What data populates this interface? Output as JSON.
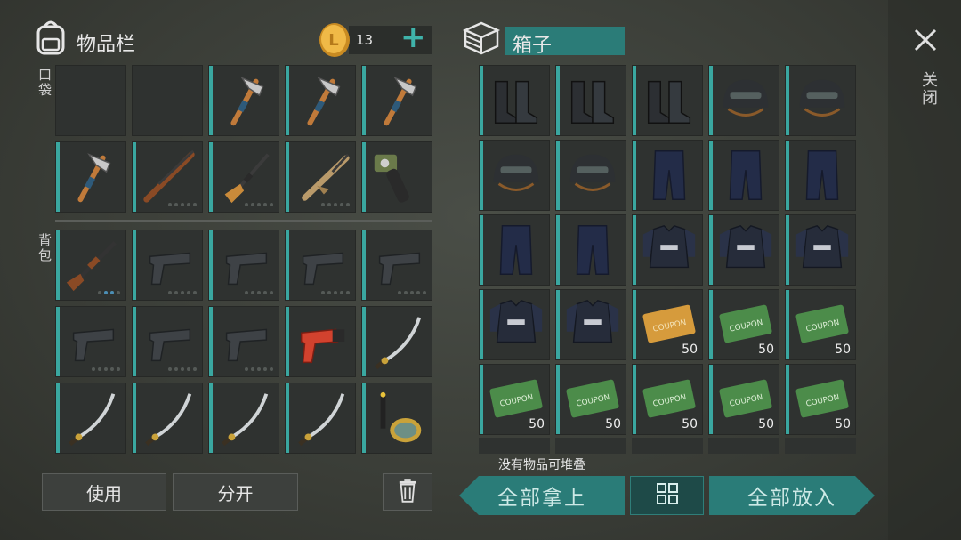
{
  "inventory": {
    "title": "物品栏",
    "pocket_label": "口袋",
    "backpack_label": "背包",
    "coins": "13",
    "add_symbol": "+"
  },
  "box": {
    "title": "箱子"
  },
  "close": {
    "label": "关闭"
  },
  "buttons": {
    "use": "使用",
    "split": "分开",
    "take_all": "全部拿上",
    "put_all": "全部放入"
  },
  "status": {
    "no_stack": "没有物品可堆叠"
  },
  "icons": {
    "backpack": "backpack-icon",
    "coin": "coin-icon",
    "box": "box-icon",
    "close": "close-icon",
    "trash": "trash-icon",
    "sort": "grid-sort-icon"
  },
  "colors": {
    "accent": "#2a7c78",
    "slot_bar": "#3aa7a0",
    "coin": "#e2a43a"
  },
  "pocket_items": [
    "",
    "",
    "hatchet",
    "hatchet",
    "hatchet",
    "hatchet",
    "shotgun",
    "rifle",
    "assault-rifle",
    "chainsaw"
  ],
  "backpack_items": [
    "pump-shotgun",
    "pistol",
    "pistol",
    "pistol",
    "pistol",
    "pistol",
    "pistol",
    "pistol",
    "flare-gun",
    "katana",
    "katana",
    "katana",
    "katana",
    "katana",
    "snorkel"
  ],
  "box_items": [
    {
      "name": "boots"
    },
    {
      "name": "boots"
    },
    {
      "name": "boots"
    },
    {
      "name": "helmet"
    },
    {
      "name": "helmet"
    },
    {
      "name": "helmet"
    },
    {
      "name": "helmet"
    },
    {
      "name": "pants"
    },
    {
      "name": "pants"
    },
    {
      "name": "pants"
    },
    {
      "name": "pants"
    },
    {
      "name": "pants"
    },
    {
      "name": "vest"
    },
    {
      "name": "vest"
    },
    {
      "name": "vest"
    },
    {
      "name": "vest"
    },
    {
      "name": "vest"
    },
    {
      "name": "survival-coupon",
      "count": "50"
    },
    {
      "name": "ration-coupon",
      "count": "50"
    },
    {
      "name": "ration-coupon",
      "count": "50"
    },
    {
      "name": "ration-coupon",
      "count": "50"
    },
    {
      "name": "ration-coupon",
      "count": "50"
    },
    {
      "name": "ration-coupon",
      "count": "50"
    },
    {
      "name": "ration-coupon",
      "count": "50"
    },
    {
      "name": "ration-coupon",
      "count": "50"
    }
  ]
}
